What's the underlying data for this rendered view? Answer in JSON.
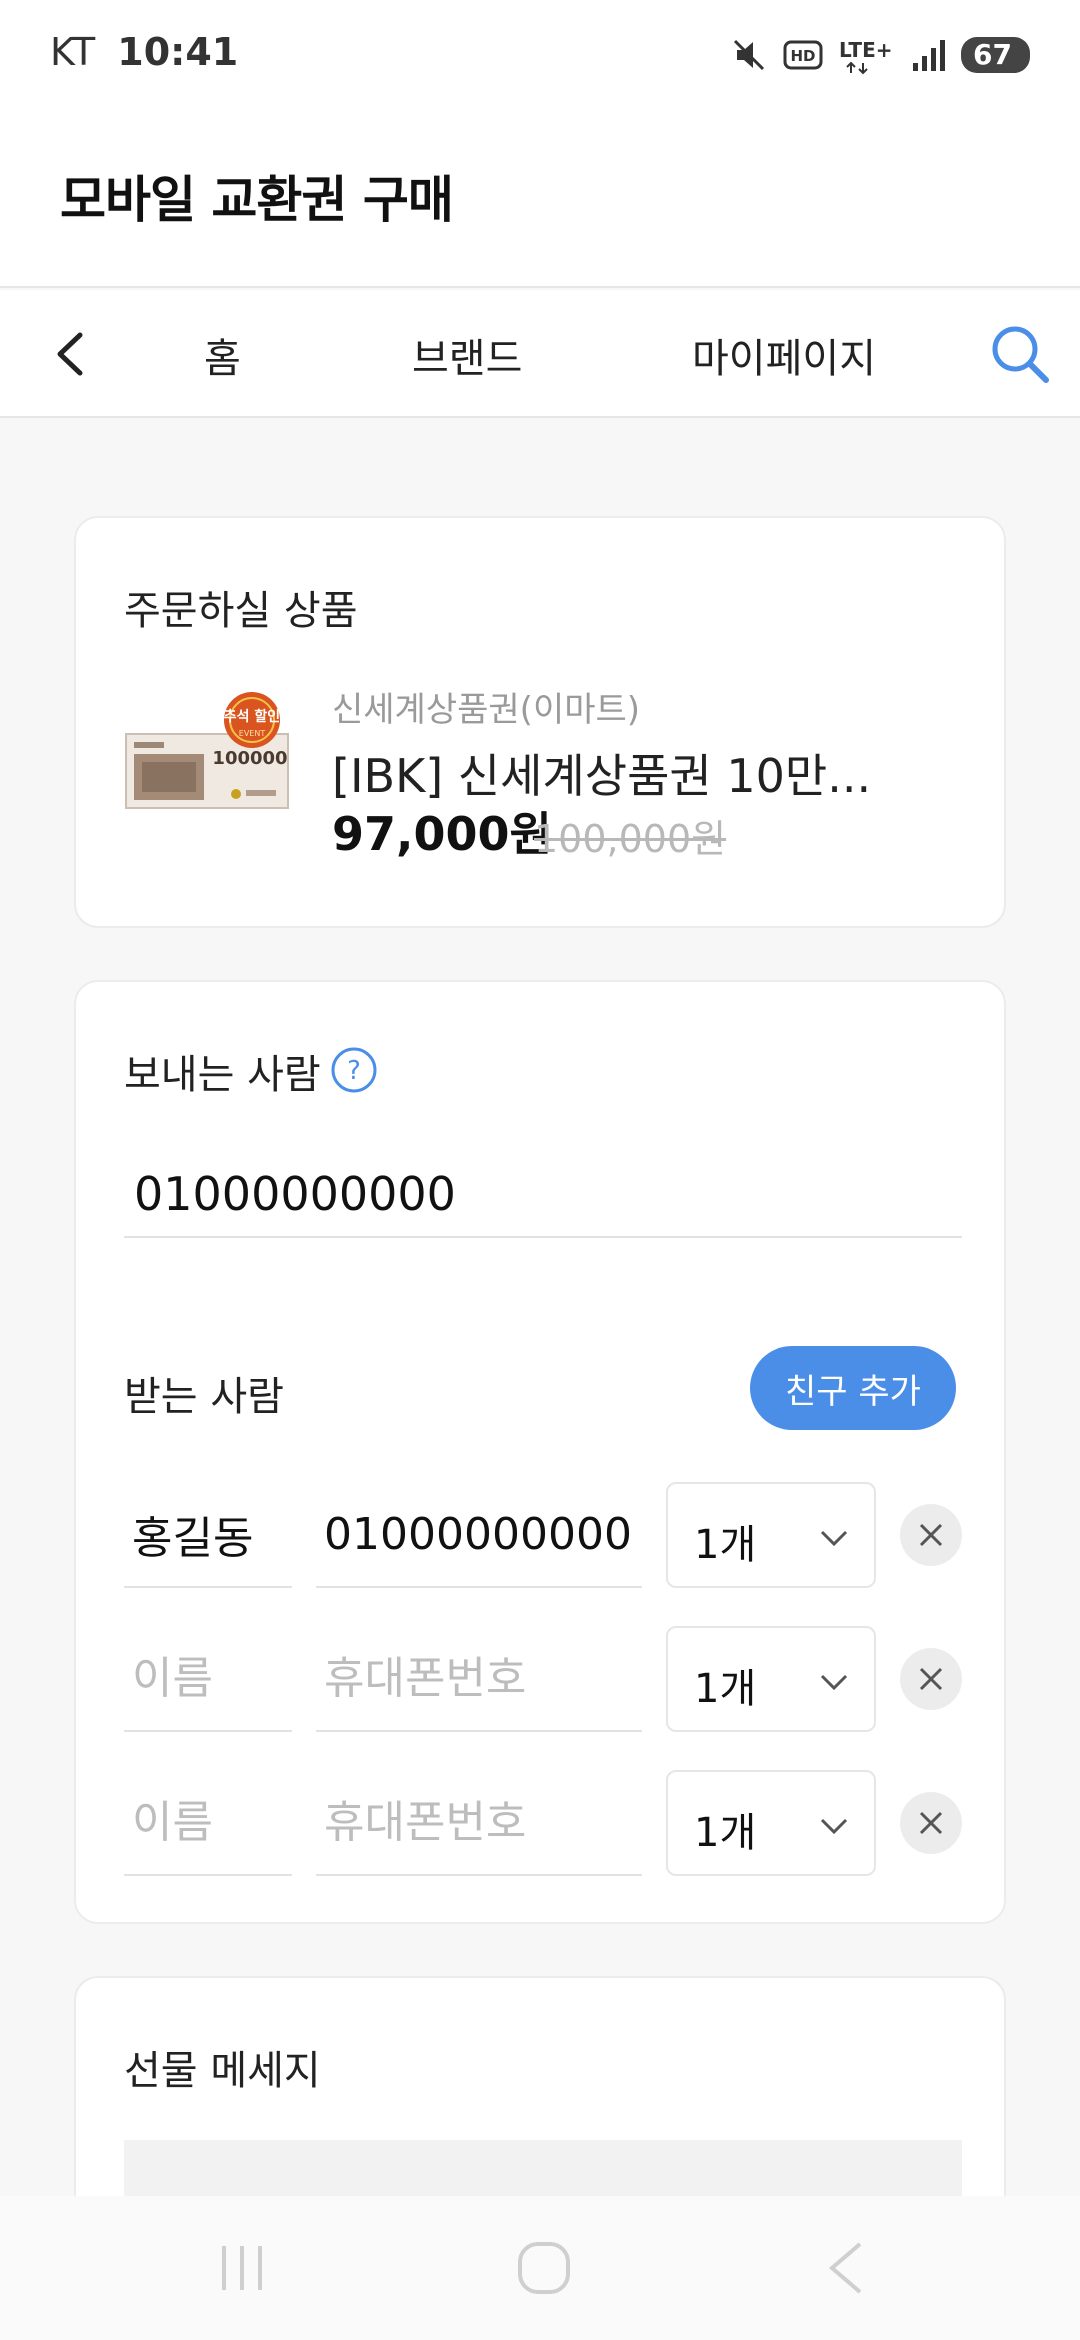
{
  "status": {
    "carrier": "KT",
    "time": "10:41",
    "battery": "67",
    "network": "LTE+"
  },
  "header": {
    "title": "모바일 교환권 구매"
  },
  "nav": {
    "tabs": [
      "홈",
      "브랜드",
      "마이페이지"
    ]
  },
  "order": {
    "section_title": "주문하실 상품",
    "product": {
      "brand": "신세계상품권(이마트)",
      "name": "[IBK] 신세계상품권 10만...",
      "price": "97,000원",
      "original_price": "100,000원",
      "badge_text": "추석 할인",
      "badge_sub": "EVENT",
      "voucher_value": "100000"
    }
  },
  "sender": {
    "label": "보내는 사람",
    "phone": "01000000000"
  },
  "receiver": {
    "label": "받는 사람",
    "add_friend_label": "친구 추가",
    "name_placeholder": "이름",
    "phone_placeholder": "휴대폰번호",
    "rows": [
      {
        "name": "홍길동",
        "phone": "01000000000",
        "qty": "1개"
      },
      {
        "name": "",
        "phone": "",
        "qty": "1개"
      },
      {
        "name": "",
        "phone": "",
        "qty": "1개"
      }
    ]
  },
  "message": {
    "label": "선물 메세지"
  },
  "colors": {
    "accent": "#4a8ee8",
    "background": "#f7f7f7"
  }
}
